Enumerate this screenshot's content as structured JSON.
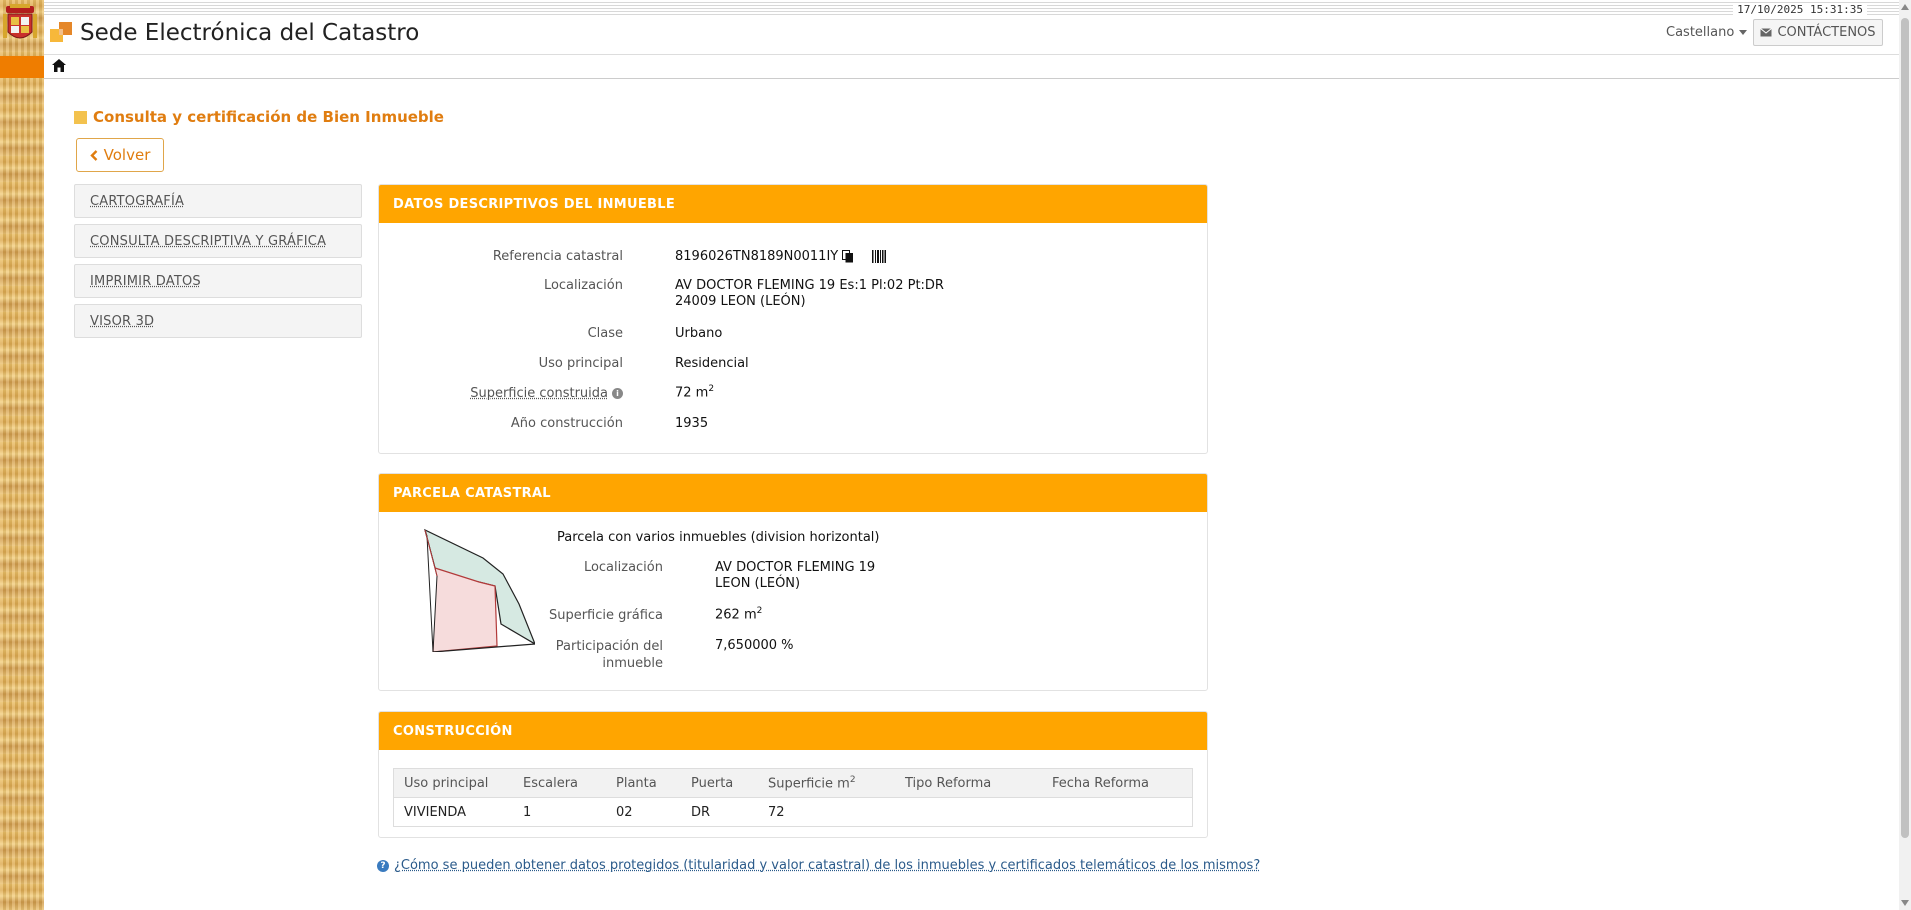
{
  "header": {
    "datetime": "17/10/2025  15:31:35",
    "site_title": "Sede Electrónica del Catastro",
    "language": "Castellano",
    "contact_label": "CONTÁCTENOS"
  },
  "page": {
    "heading": "Consulta y certificación de Bien Inmueble",
    "back_label": "Volver"
  },
  "sidebar": {
    "items": [
      {
        "label": "CARTOGRAFÍA"
      },
      {
        "label": "CONSULTA DESCRIPTIVA Y GRÁFICA"
      },
      {
        "label": "IMPRIMIR DATOS"
      },
      {
        "label": "VISOR 3D"
      }
    ]
  },
  "datos": {
    "title": "DATOS DESCRIPTIVOS DEL INMUEBLE",
    "ref_label": "Referencia catastral",
    "ref_value": "8196026TN8189N0011IY",
    "loc_label": "Localización",
    "loc_line1": "AV DOCTOR FLEMING 19 Es:1 Pl:02 Pt:DR",
    "loc_line2": "24009 LEON (LEÓN)",
    "clase_label": "Clase",
    "clase_value": "Urbano",
    "uso_label": "Uso principal",
    "uso_value": "Residencial",
    "sup_label": "Superficie construida",
    "sup_value": "72 m",
    "sup_unit_exp": "2",
    "anio_label": "Año construcción",
    "anio_value": "1935"
  },
  "parcela": {
    "title": "PARCELA CATASTRAL",
    "desc": "Parcela con varios inmuebles (division horizontal)",
    "loc_label": "Localización",
    "loc_line1": "AV DOCTOR FLEMING 19",
    "loc_line2": "LEON (LEÓN)",
    "sup_label": "Superficie gráfica",
    "sup_value": "262 m",
    "sup_unit_exp": "2",
    "part_label_1": "Participación del",
    "part_label_2": "inmueble",
    "part_value": "7,650000 %"
  },
  "construccion": {
    "title": "CONSTRUCCIÓN",
    "headers": [
      "Uso principal",
      "Escalera",
      "Planta",
      "Puerta",
      "Superficie m",
      "Tipo Reforma",
      "Fecha Reforma"
    ],
    "sup_header_exp": "2",
    "rows": [
      [
        "VIVIENDA",
        "1",
        "02",
        "DR",
        "72",
        "",
        ""
      ]
    ]
  },
  "help": {
    "link_text": "¿Cómo se pueden obtener datos protegidos (titularidad y valor catastral) de los inmuebles y certificados telemáticos de los mismos?"
  },
  "colors": {
    "panel_header": "#ffa500",
    "heading_orange": "#e07d10",
    "link_blue": "#2a5a8a"
  },
  "icons": [
    "home-icon",
    "envelope-icon",
    "copy-icon",
    "barcode-icon",
    "info-icon",
    "question-icon",
    "chevron-left-icon",
    "coat-of-arms-icon",
    "catastro-logo-icon"
  ]
}
